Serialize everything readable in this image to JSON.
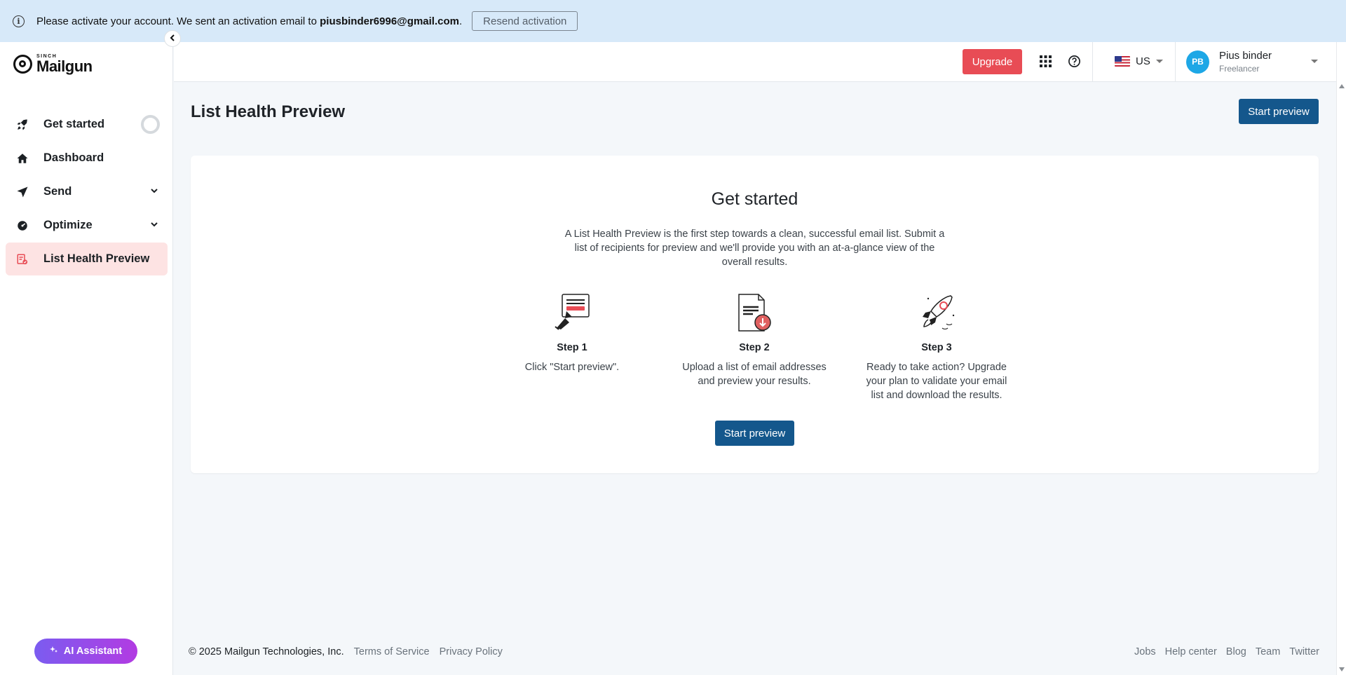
{
  "banner": {
    "message": "Please activate your account. We sent an activation email to",
    "email": "piusbinder6996@gmail.com",
    "period": ".",
    "resend_label": "Resend activation"
  },
  "sidebar": {
    "logo_small": "SINCH",
    "logo_name": "Mailgun",
    "items": [
      {
        "label": "Get started",
        "icon": "rocket-icon"
      },
      {
        "label": "Dashboard",
        "icon": "home-icon"
      },
      {
        "label": "Send",
        "icon": "send-icon"
      },
      {
        "label": "Optimize",
        "icon": "optimize-icon"
      },
      {
        "label": "List Health Preview",
        "icon": "list-health-icon",
        "active": true
      }
    ],
    "ai_label": "AI Assistant"
  },
  "topbar": {
    "upgrade_label": "Upgrade",
    "region": "US",
    "user_initials": "PB",
    "user_name": "Pius binder",
    "user_plan": "Freelancer"
  },
  "main": {
    "title": "List Health Preview",
    "start_label": "Start preview",
    "card": {
      "title": "Get started",
      "description": "A List Health Preview is the first step towards a clean, successful email list. Submit a list of recipients for preview and we'll provide you with an at-a-glance view of the overall results.",
      "steps": [
        {
          "name": "Step 1",
          "desc": "Click \"Start preview\"."
        },
        {
          "name": "Step 2",
          "desc": "Upload a list of email addresses and preview your results."
        },
        {
          "name": "Step 3",
          "desc": "Ready to take action? Upgrade your plan to validate your email list and download the results."
        }
      ],
      "button_label": "Start preview"
    }
  },
  "footer": {
    "copyright": "© 2025 Mailgun Technologies, Inc.",
    "left_links": [
      "Terms of Service",
      "Privacy Policy"
    ],
    "right_links": [
      "Jobs",
      "Help center",
      "Blog",
      "Team",
      "Twitter"
    ]
  },
  "colors": {
    "banner_bg": "#d7e9f9",
    "upgrade": "#e84c55",
    "primary": "#14578c",
    "active_nav": "#fde3e3",
    "avatar": "#1da7e6"
  }
}
